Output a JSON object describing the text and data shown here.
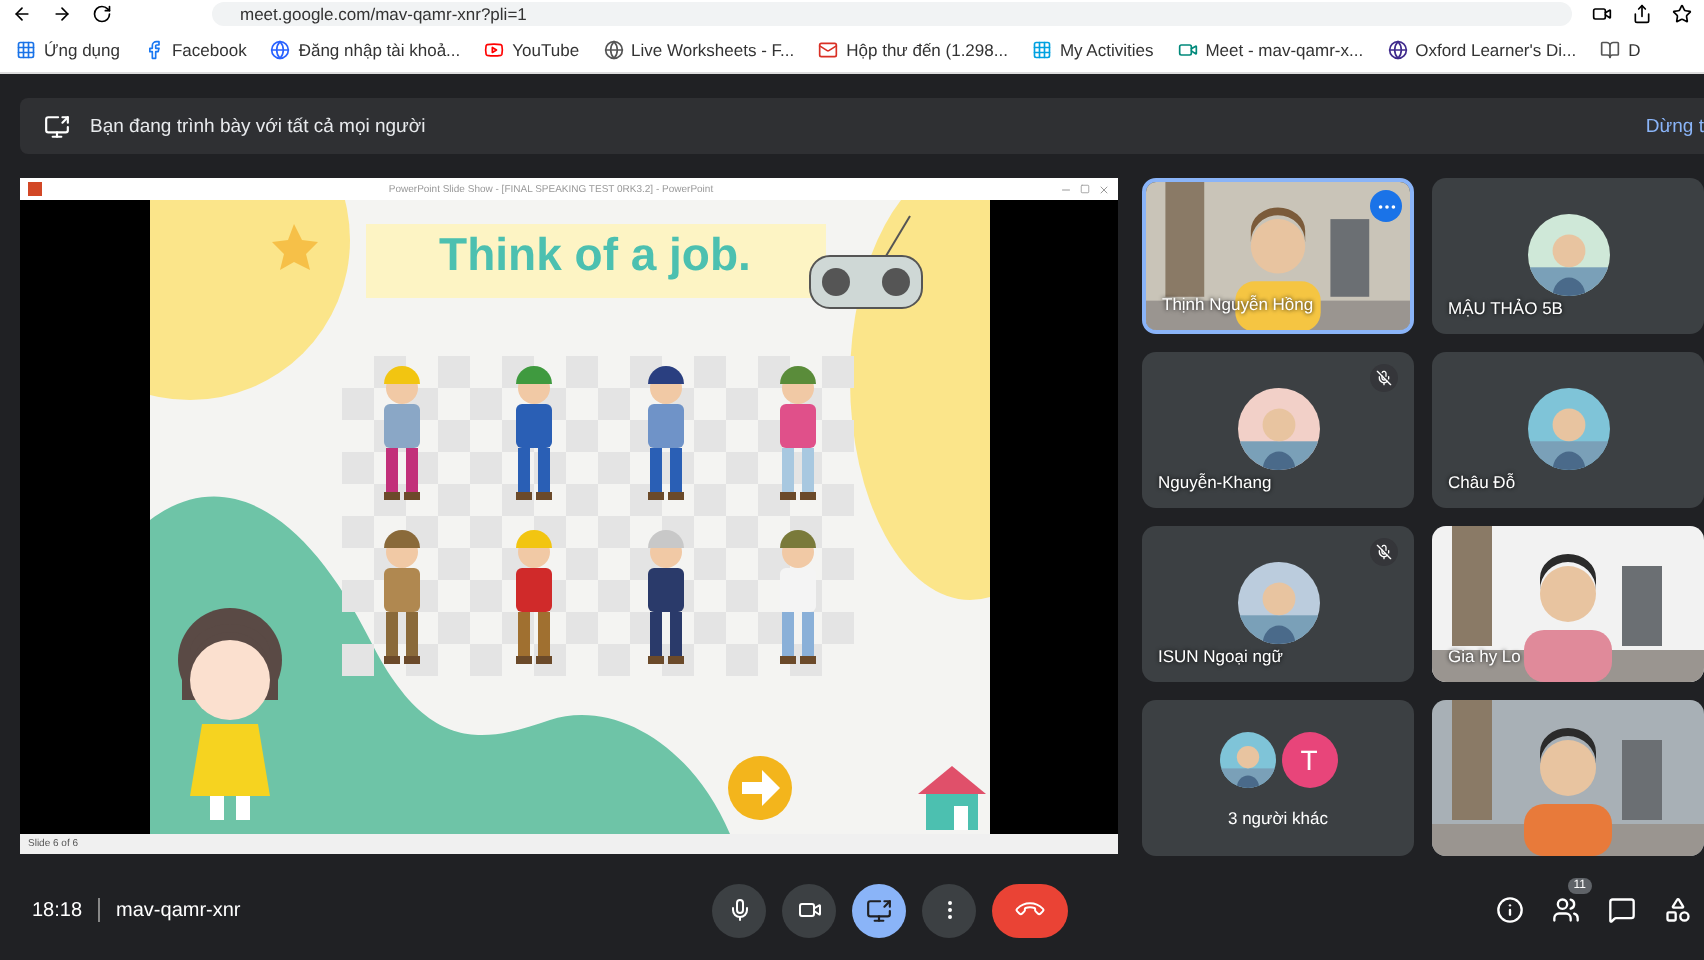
{
  "browser": {
    "url": "meet.google.com/mav-qamr-xnr?pli=1",
    "bookmarks": [
      {
        "label": "Ứng dụng",
        "kind": "apps"
      },
      {
        "label": "Facebook",
        "kind": "facebook"
      },
      {
        "label": "Đăng nhập tài khoả...",
        "kind": "login"
      },
      {
        "label": "YouTube",
        "kind": "youtube"
      },
      {
        "label": "Live Worksheets - F...",
        "kind": "globe"
      },
      {
        "label": "Hộp thư đến (1.298...",
        "kind": "mail"
      },
      {
        "label": "My Activities",
        "kind": "grid"
      },
      {
        "label": "Meet - mav-qamr-x...",
        "kind": "meet"
      },
      {
        "label": "Oxford Learner's Di...",
        "kind": "oxford"
      },
      {
        "label": "D",
        "kind": "doc"
      }
    ]
  },
  "banner": {
    "text": "Bạn đang trình bày với tất cả mọi người",
    "action": "Dừng t"
  },
  "presentation": {
    "window_title": "PowerPoint Slide Show - [FINAL SPEAKING TEST 0RK3.2] - PowerPoint",
    "slide_title": "Think of a job.",
    "status": "Slide 6 of 6"
  },
  "participants": [
    {
      "name": "Thịnh Nguyễn Hồng",
      "kind": "video",
      "muted": false,
      "highlighted": true
    },
    {
      "name": "MẬU THẢO 5B",
      "kind": "avatar",
      "muted": false,
      "highlighted": false
    },
    {
      "name": "Nguyễn-Khang",
      "kind": "avatar",
      "muted": true,
      "highlighted": false
    },
    {
      "name": "Châu Đỗ",
      "kind": "avatar",
      "muted": false,
      "highlighted": false
    },
    {
      "name": "ISUN Ngoại ngữ",
      "kind": "avatar",
      "muted": true,
      "highlighted": false
    },
    {
      "name": "Gia hy Lo",
      "kind": "video",
      "muted": false,
      "highlighted": false
    },
    {
      "name": "3 người khác",
      "kind": "group",
      "initial": "T",
      "muted": false,
      "highlighted": false
    },
    {
      "kind": "video",
      "muted": false,
      "highlighted": false
    }
  ],
  "bottom_bar": {
    "time": "18:18",
    "meeting_code": "mav-qamr-xnr",
    "people_count": "11"
  }
}
